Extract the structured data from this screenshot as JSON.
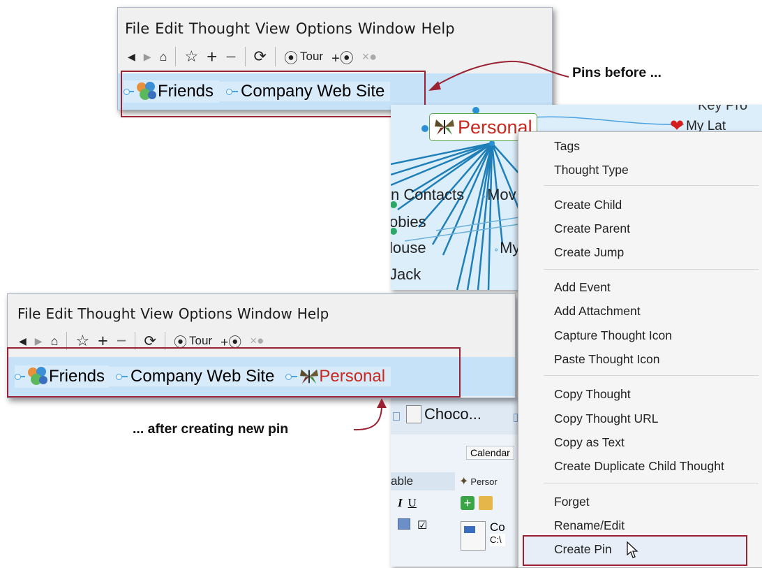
{
  "top_window": {
    "menu": [
      "File",
      "Edit",
      "Thought",
      "View",
      "Options",
      "Window",
      "Help"
    ],
    "toolbar": {
      "tour_label": "Tour",
      "buttons": [
        "back-icon",
        "forward-icon",
        "home-icon",
        "layout-icon",
        "plus-icon",
        "minus-icon",
        "refresh-icon",
        "tour-icon",
        "add-tour-icon",
        "remove-tour-icon"
      ]
    },
    "pins": [
      "Friends",
      "Company Web Site"
    ]
  },
  "bottom_window": {
    "menu": [
      "File",
      "Edit",
      "Thought",
      "View",
      "Options",
      "Window",
      "Help"
    ],
    "toolbar": {
      "tour_label": "Tour"
    },
    "pins": [
      "Friends",
      "Company Web Site",
      "Personal"
    ]
  },
  "annotations": {
    "before": "Pins before ...",
    "after": "... after creating new pin"
  },
  "brain": {
    "active_thought": "Personal",
    "top_partial": "Key Pro",
    "right_partial": "My Lat",
    "nodes": [
      "n Contacts",
      "Mov",
      "obies",
      "louse",
      "My",
      "Jack"
    ]
  },
  "context_menu": {
    "groups": [
      [
        "Tags",
        "Thought Type"
      ],
      [
        "Create Child",
        "Create Parent",
        "Create Jump"
      ],
      [
        "Add Event",
        "Add Attachment",
        "Capture Thought Icon",
        "Paste Thought Icon"
      ],
      [
        "Copy Thought",
        "Copy Thought URL",
        "Copy as Text",
        "Create Duplicate Child Thought"
      ],
      [
        "Forget",
        "Rename/Edit",
        "Create Pin"
      ]
    ],
    "highlighted": "Create Pin"
  },
  "content_panel": {
    "tab_label": "Choco...",
    "calendar_label": "Calendar",
    "side_label": "able",
    "thought_label": "Persor",
    "format_italic": "I",
    "format_underline": "U",
    "attachment_name": "Co",
    "attachment_path": "C:\\"
  },
  "colors": {
    "pin_bar": "#c6e2f8",
    "pin_hook": "#4aa3e0",
    "red_box": "#9a2233",
    "active_thought_text": "#c8281e",
    "brain_bg": "#ddeefb",
    "link_color": "#1f7fb8"
  }
}
